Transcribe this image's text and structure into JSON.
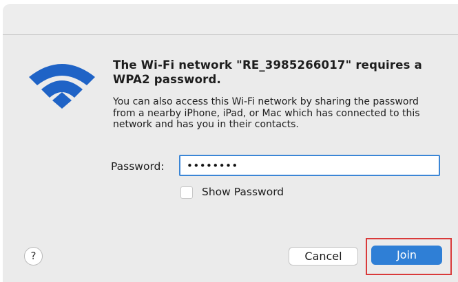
{
  "dialog": {
    "title": "The Wi-Fi network \"RE_3985266017\" requires a WPA2 password.",
    "description": "You can also access this Wi-Fi network by sharing the password from a nearby iPhone, iPad, or Mac which has connected to this network and has you in their contacts.",
    "password_label": "Password:",
    "password_value": "••••••••",
    "show_password_label": "Show Password",
    "show_password_checked": false,
    "help_label": "?",
    "cancel_label": "Cancel",
    "join_label": "Join",
    "icon": "wifi-icon"
  },
  "colors": {
    "accent": "#2f7fd6",
    "icon_blue": "#1f63c6",
    "highlight": "#d93a3a",
    "panel_bg": "#ebebeb"
  }
}
